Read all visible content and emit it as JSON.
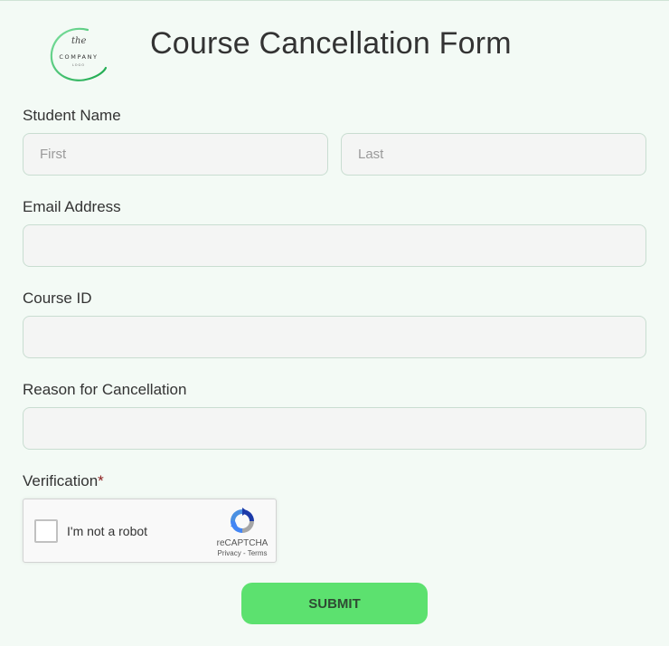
{
  "header": {
    "logo_text_script": "the",
    "logo_text_main": "COMPANY",
    "logo_text_sub": "LOGO",
    "title": "Course Cancellation Form"
  },
  "fields": {
    "student_name": {
      "label": "Student Name",
      "first_placeholder": "First",
      "last_placeholder": "Last"
    },
    "email": {
      "label": "Email Address"
    },
    "course_id": {
      "label": "Course ID"
    },
    "reason": {
      "label": "Reason for Cancellation"
    },
    "verification": {
      "label": "Verification",
      "required_mark": "*"
    }
  },
  "recaptcha": {
    "label": "I'm not a robot",
    "brand": "reCAPTCHA",
    "links": "Privacy - Terms"
  },
  "submit": {
    "label": "SUBMIT"
  },
  "colors": {
    "background": "#f3faf5",
    "accent": "#5ce16f",
    "logo_green": "#2fbf5f",
    "required": "#8b1d1d"
  }
}
